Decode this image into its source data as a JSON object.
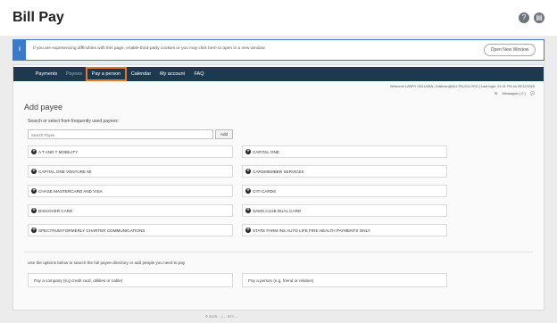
{
  "page": {
    "title": "Bill Pay"
  },
  "notice": {
    "text": "If you are experiencing difficulties with this page, enable third-party cookies or you may click here to open in a new window.",
    "open_button": "Open New Window"
  },
  "nav": [
    {
      "label": "Payments",
      "state": "normal"
    },
    {
      "label": "Payees",
      "state": "dim"
    },
    {
      "label": "Pay a person",
      "state": "highlighted"
    },
    {
      "label": "Calendar",
      "state": "normal"
    },
    {
      "label": "My account",
      "state": "normal"
    },
    {
      "label": "FAQ",
      "state": "normal"
    }
  ],
  "user": {
    "info": "Welcome LARRY HALLMAN | lhallman@ALLTRUCU.ORG | Last login: 01:41 PM on 09/12/2025",
    "messages": "Messages ( 0 )"
  },
  "add_payee": {
    "title": "Add payee",
    "search_label": "Search or select from frequently used payees:",
    "search_placeholder": "Search Payee",
    "add_button": "Add"
  },
  "payees": [
    "A T AND T MOBILITY",
    "CAPITAL ONE",
    "CAPITAL ONE VENTURE MI",
    "CARDMEMBER SERVICES",
    "CHASE MASTERCARD AND VISA",
    "CITI CARDS",
    "DISCOVER CARD",
    "SAMS CLUB DUAL CARD",
    "SPECTRUM FORMERLY CHARTER COMMUNICATIONS",
    "STATE FARM INS AUTO LIFE FIRE HEALTH PAYMENTS ONLY"
  ],
  "options": {
    "text": "Use the options below to search the full payee directory or add people you need to pay",
    "company": "Pay a company (e.g credit card, utilities or cable)",
    "person": "Pay a person (e.g. friend or relative)"
  },
  "footer": "© 2025 ... | ... 877-... "
}
